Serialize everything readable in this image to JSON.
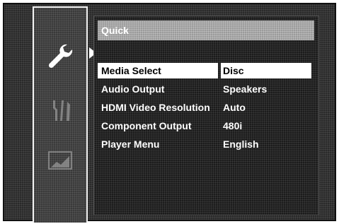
{
  "sidebar": {
    "icons": [
      "wrench-icon",
      "tools-icon",
      "display-icon"
    ],
    "active_index": 0
  },
  "panel": {
    "title": "Quick"
  },
  "menu": {
    "items": [
      {
        "label": "Media Select",
        "value": "Disc",
        "selected": true
      },
      {
        "label": "Audio Output",
        "value": "Speakers",
        "selected": false
      },
      {
        "label": "HDMI Video Resolution",
        "value": "Auto",
        "selected": false
      },
      {
        "label": "Component Output",
        "value": "480i",
        "selected": false
      },
      {
        "label": "Player Menu",
        "value": "English",
        "selected": false
      }
    ]
  },
  "colors": {
    "background": "#2a2a2a",
    "title_bar": "#9b9b9b",
    "highlight": "#ffffff",
    "text": "#ffffff"
  }
}
